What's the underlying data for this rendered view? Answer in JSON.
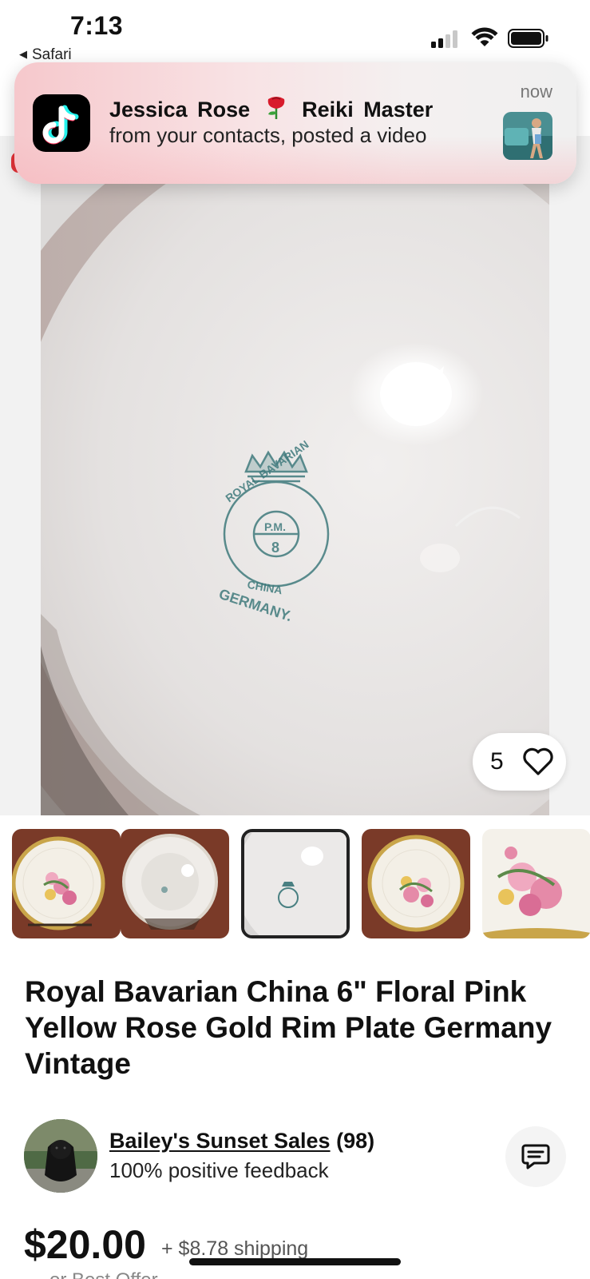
{
  "status_bar": {
    "time": "7:13",
    "back_app": "Safari",
    "back_arrow": "◀"
  },
  "notification": {
    "app_icon": "tiktok-icon",
    "title_name": "Jessica Rose",
    "title_role": "Reiki Master",
    "body": "from your contacts, posted a video",
    "time": "now"
  },
  "product_image": {
    "stamp_top": "ROYAL BAVARIAN",
    "stamp_mid": "P.M.",
    "stamp_num": "8",
    "stamp_china": "CHINA",
    "stamp_bottom": "GERMANY."
  },
  "like": {
    "count": "5",
    "icon": "heart-icon"
  },
  "thumbnails": [
    {
      "label": "front-plate-photo"
    },
    {
      "label": "back-plate-photo"
    },
    {
      "label": "stamp-closeup-photo",
      "selected": true
    },
    {
      "label": "front-plate-photo-2"
    },
    {
      "label": "floral-closeup-photo"
    }
  ],
  "listing": {
    "title": "Royal Bavarian China 6\" Floral Pink Yellow Rose Gold Rim Plate Germany Vintage"
  },
  "seller": {
    "name": "Bailey's Sunset Sales",
    "count": "(98)",
    "feedback": "100% positive feedback"
  },
  "pricing": {
    "price": "$20.00",
    "shipping": "+ $8.78 shipping",
    "best_offer": "or Best Offer"
  },
  "colors": {
    "ebay_red": "#e53238",
    "tiktok_cyan": "#25f4ee",
    "tiktok_pink": "#fe2c55"
  }
}
